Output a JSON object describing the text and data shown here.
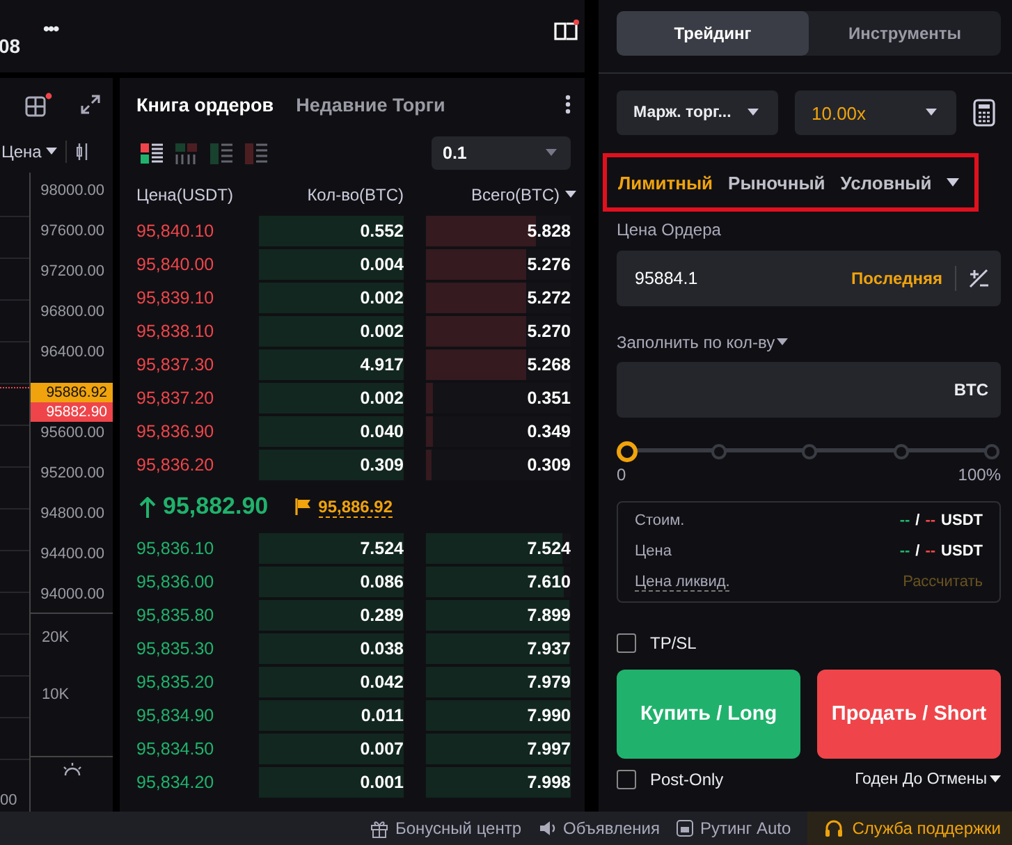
{
  "top_bar": {
    "ticker_fragment": "08",
    "more": "•••"
  },
  "chart": {
    "price_filter": "Цена",
    "axis_labels": [
      "98000.00",
      "97600.00",
      "97200.00",
      "96800.00",
      "96400.00"
    ],
    "price_tags": [
      {
        "value": "95886.92",
        "color": "#f0a30c"
      },
      {
        "value": "95882.90",
        "color": "#ef454a"
      }
    ],
    "axis_labels_lower": [
      "95200.00",
      "94800.00",
      "94400.00",
      "94000.00"
    ],
    "axis_label_mid": "95600.00",
    "volume_labels": [
      "20K",
      "10K"
    ],
    "time_fragment": "00"
  },
  "orderbook": {
    "tabs": [
      {
        "label": "Книга ордеров",
        "selected": true
      },
      {
        "label": "Недавние Торги",
        "selected": false
      }
    ],
    "view_modes": [
      {
        "kind": "split",
        "selected": true
      },
      {
        "kind": "columns",
        "selected": false
      },
      {
        "kind": "bids",
        "selected": false
      },
      {
        "kind": "asks",
        "selected": false
      }
    ],
    "precision": "0.1",
    "columns": [
      "Цена(USDT)",
      "Кол-во(BTC)",
      "Всего(BTC)"
    ],
    "asks": [
      {
        "price": "95,840.10",
        "qty": "0.552",
        "total": "5.828",
        "level": 0.76
      },
      {
        "price": "95,840.00",
        "qty": "0.004",
        "total": "5.276",
        "level": 0.69
      },
      {
        "price": "95,839.10",
        "qty": "0.002",
        "total": "5.272",
        "level": 0.69
      },
      {
        "price": "95,838.10",
        "qty": "0.002",
        "total": "5.270",
        "level": 0.69
      },
      {
        "price": "95,837.30",
        "qty": "4.917",
        "total": "5.268",
        "level": 0.69
      },
      {
        "price": "95,837.20",
        "qty": "0.002",
        "total": "0.351",
        "level": 0.05
      },
      {
        "price": "95,836.90",
        "qty": "0.040",
        "total": "0.349",
        "level": 0.05
      },
      {
        "price": "95,836.20",
        "qty": "0.309",
        "total": "0.309",
        "level": 0.04
      }
    ],
    "last_price": {
      "value": "95,882.90"
    },
    "mark_price": "95,886.92",
    "bids": [
      {
        "price": "95,836.10",
        "qty": "7.524",
        "total": "7.524",
        "level": 0.94
      },
      {
        "price": "95,836.00",
        "qty": "0.086",
        "total": "7.610",
        "level": 0.95
      },
      {
        "price": "95,835.80",
        "qty": "0.289",
        "total": "7.899",
        "level": 0.99
      },
      {
        "price": "95,835.30",
        "qty": "0.038",
        "total": "7.937",
        "level": 0.99
      },
      {
        "price": "95,835.20",
        "qty": "0.042",
        "total": "7.979",
        "level": 1
      },
      {
        "price": "95,834.90",
        "qty": "0.011",
        "total": "7.990",
        "level": 1
      },
      {
        "price": "95,834.50",
        "qty": "0.007",
        "total": "7.997",
        "level": 1
      },
      {
        "price": "95,834.20",
        "qty": "0.001",
        "total": "7.998",
        "level": 1
      }
    ]
  },
  "trade_panel": {
    "tabs": [
      {
        "label": "Трейдинг",
        "selected": true
      },
      {
        "label": "Инструменты",
        "selected": false
      }
    ],
    "margin_mode": "Марж. торг...",
    "leverage": "10.00x",
    "order_types": [
      {
        "label": "Лимитный",
        "selected": true
      },
      {
        "label": "Рыночный",
        "selected": false
      },
      {
        "label": "Условный",
        "selected": false
      }
    ],
    "price_label": "Цена Ордера",
    "price_value": "95884.1",
    "price_ref": "Последняя",
    "qty_label": "Заполнить по кол-ву",
    "qty_unit": "BTC",
    "slider": {
      "level": 0,
      "min_label": "0",
      "max_label": "100%"
    },
    "info": [
      {
        "kind": "value",
        "label": "Стоим.",
        "buy": "--",
        "sep": "/",
        "sell": "--",
        "unit": "USDT"
      },
      {
        "kind": "value",
        "label": "Цена",
        "buy": "--",
        "sep": "/",
        "sell": "--",
        "unit": "USDT"
      },
      {
        "kind": "action",
        "label": "Цена ликвид.",
        "action": "Рассчитать"
      }
    ],
    "tpsl": {
      "label": "TP/SL",
      "checked": false
    },
    "buy_button": "Купить / Long",
    "sell_button": "Продать / Short",
    "post_only": {
      "label": "Post-Only",
      "checked": false
    },
    "time_in_force": "Годен До Отмены"
  },
  "status_bar": {
    "items": [
      {
        "kind": "gift",
        "label": "Бонусный центр"
      },
      {
        "kind": "speaker",
        "label": "Объявления"
      },
      {
        "kind": "route",
        "label": "Рутинг Auto"
      }
    ],
    "support": "Служба поддержки"
  }
}
